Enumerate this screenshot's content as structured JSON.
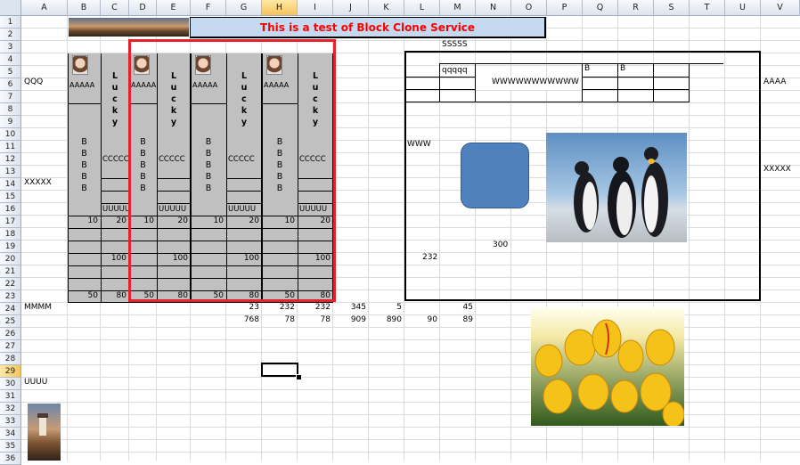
{
  "columns": [
    "A",
    "B",
    "C",
    "D",
    "E",
    "F",
    "G",
    "H",
    "I",
    "J",
    "K",
    "L",
    "M",
    "N",
    "O",
    "P",
    "Q",
    "R",
    "S",
    "T",
    "U",
    "V"
  ],
  "rows": [
    "1",
    "2",
    "3",
    "4",
    "5",
    "6",
    "7",
    "8",
    "9",
    "10",
    "11",
    "12",
    "13",
    "14",
    "15",
    "16",
    "17",
    "18",
    "19",
    "20",
    "21",
    "22",
    "23",
    "24",
    "25",
    "26",
    "27",
    "28",
    "29",
    "30",
    "31",
    "32",
    "33",
    "34",
    "35",
    "36"
  ],
  "selected_column": "H",
  "selected_row": "29",
  "banner_text": "This is a test of Block Clone Service",
  "colors": {
    "banner_text": "#ff0000",
    "banner_bg": "#c5d9f1",
    "clone_border": "#e8202a",
    "block_gray": "#c0c0c0",
    "shape_fill": "#4f81bd"
  },
  "left_labels": {
    "qqq": "QQQ",
    "xxxxx": "XXXXX",
    "mmmm": "MMMM",
    "uuuu": "UUUU"
  },
  "block": {
    "aaaaa": "AAAAA",
    "lucky": [
      "L",
      "u",
      "c",
      "k",
      "y"
    ],
    "bbbbb": [
      "B",
      "B",
      "B",
      "B",
      "B"
    ],
    "ccccc": "CCCCC",
    "uuuuu": "UUUUU",
    "v10": "10",
    "v20": "20",
    "v100": "100",
    "v50": "50",
    "v80": "80"
  },
  "row24": [
    "23",
    "232",
    "232",
    "345",
    "5",
    "45"
  ],
  "row25": [
    "768",
    "78",
    "78",
    "909",
    "890",
    "90",
    "89"
  ],
  "right_box": {
    "sssss": "SSSSS",
    "qqqqq": "qqqqq",
    "wwww_long": "WWWWWWWWWWW",
    "b1": "B",
    "b2": "B",
    "www": "WWW",
    "aaaa": "AAAA",
    "xxxxx": "XXXXX",
    "n300": "300",
    "n232": "232"
  }
}
